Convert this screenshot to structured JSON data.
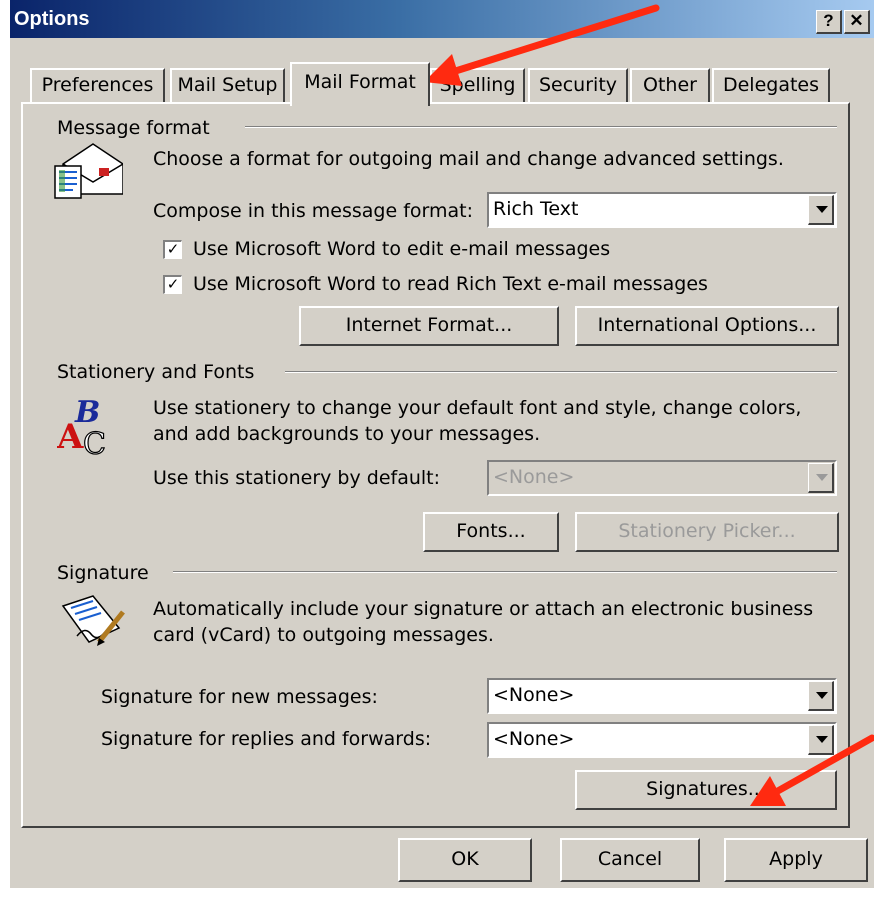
{
  "window": {
    "title": "Options",
    "help_label": "?",
    "close_label": "✕"
  },
  "tabs": [
    {
      "label": "Preferences"
    },
    {
      "label": "Mail Setup"
    },
    {
      "label": "Mail Format"
    },
    {
      "label": "Spelling"
    },
    {
      "label": "Security"
    },
    {
      "label": "Other"
    },
    {
      "label": "Delegates"
    }
  ],
  "message_format": {
    "heading": "Message format",
    "description": "Choose a format for outgoing mail and change advanced settings.",
    "compose_label": "Compose in this message format:",
    "compose_value": "Rich Text",
    "word_edit_label": "Use Microsoft Word to edit e-mail messages",
    "word_edit_checked": true,
    "word_read_label": "Use Microsoft Word to read Rich Text e-mail messages",
    "word_read_checked": true,
    "internet_format_button": "Internet Format...",
    "international_options_button": "International Options..."
  },
  "stationery": {
    "heading": "Stationery and Fonts",
    "description_line1": "Use stationery to change your default font and style, change colors,",
    "description_line2": "and add backgrounds to your messages.",
    "default_label": "Use this stationery by default:",
    "default_value": "<None>",
    "fonts_button": "Fonts...",
    "picker_button": "Stationery Picker..."
  },
  "signature": {
    "heading": "Signature",
    "description_line1": "Automatically include your signature or attach an electronic business",
    "description_line2": "card (vCard) to outgoing messages.",
    "new_label": "Signature for new messages:",
    "new_value": "<None>",
    "reply_label": "Signature for replies and forwards:",
    "reply_value": "<None>",
    "signatures_button": "Signatures..."
  },
  "footer": {
    "ok": "OK",
    "cancel": "Cancel",
    "apply": "Apply"
  },
  "check_mark": "✓",
  "colors": {
    "dialog_bg": "#d4d0c8",
    "title_start": "#0a246a",
    "title_end": "#a6caf0",
    "annotation_arrow": "#ff2a10"
  }
}
